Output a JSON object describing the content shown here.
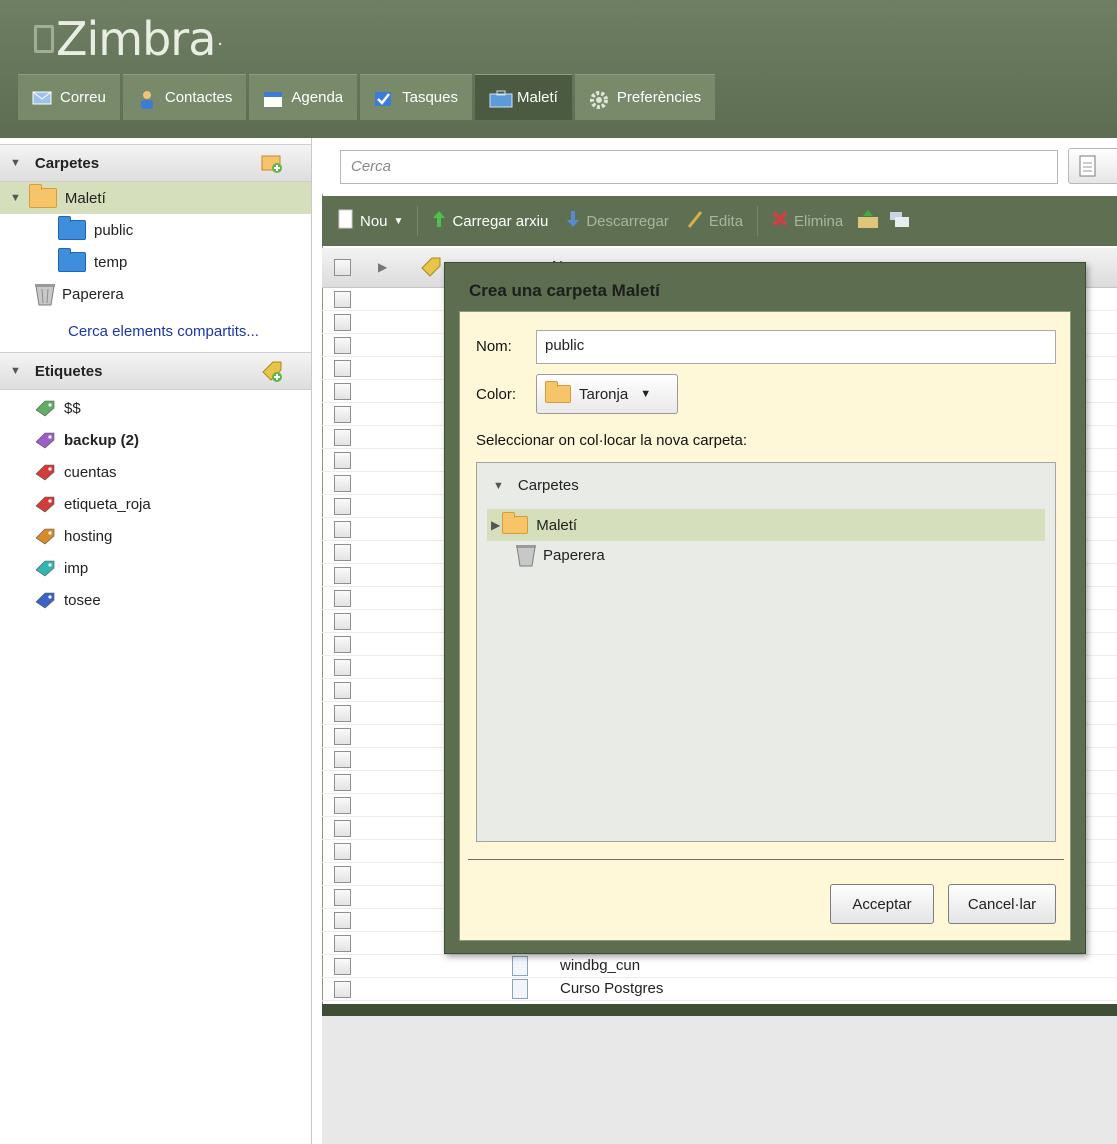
{
  "app": {
    "logo_text": "Zimbra"
  },
  "tabs": [
    {
      "label": "Correu"
    },
    {
      "label": "Contactes"
    },
    {
      "label": "Agenda"
    },
    {
      "label": "Tasques"
    },
    {
      "label": "Maletí"
    },
    {
      "label": "Preferències"
    }
  ],
  "left": {
    "folders_header": "Carpetes",
    "folders": {
      "briefcase": "Maletí",
      "public": "public",
      "temp": "temp",
      "trash": "Paperera"
    },
    "shared_link": "Cerca elements compartits...",
    "tags_header": "Etiquetes",
    "tags": [
      {
        "label": "$$",
        "color": "#5fae63"
      },
      {
        "label": "backup (2)",
        "color": "#9b5fc6"
      },
      {
        "label": "cuentas",
        "color": "#d43b3b"
      },
      {
        "label": "etiqueta_roja",
        "color": "#d43b3b"
      },
      {
        "label": "hosting",
        "color": "#d98b2b"
      },
      {
        "label": "imp",
        "color": "#2fb6b0"
      },
      {
        "label": "tosee",
        "color": "#3b64c6"
      }
    ]
  },
  "search": {
    "placeholder": "Cerca"
  },
  "toolbar": {
    "new": "Nou",
    "upload": "Carregar arxiu",
    "download": "Descarregar",
    "edit": "Edita",
    "delete": "Elimina"
  },
  "list": {
    "header_partial": "N",
    "visible_names": [
      "windbg_cun",
      "Curso Postgres"
    ]
  },
  "dialog": {
    "title": "Crea una carpeta Maletí",
    "name_label": "Nom:",
    "name_value": "public",
    "color_label": "Color:",
    "color_value": "Taronja",
    "location_label": "Seleccionar on col·locar la nova carpeta:",
    "tree": {
      "root": "Carpetes",
      "briefcase": "Maletí",
      "trash": "Paperera"
    },
    "ok": "Acceptar",
    "cancel": "Cancel·lar"
  },
  "colors": {
    "accent": "#5d6e50",
    "selection": "#d6dfbb",
    "dialog_bg": "#fff8d8"
  }
}
